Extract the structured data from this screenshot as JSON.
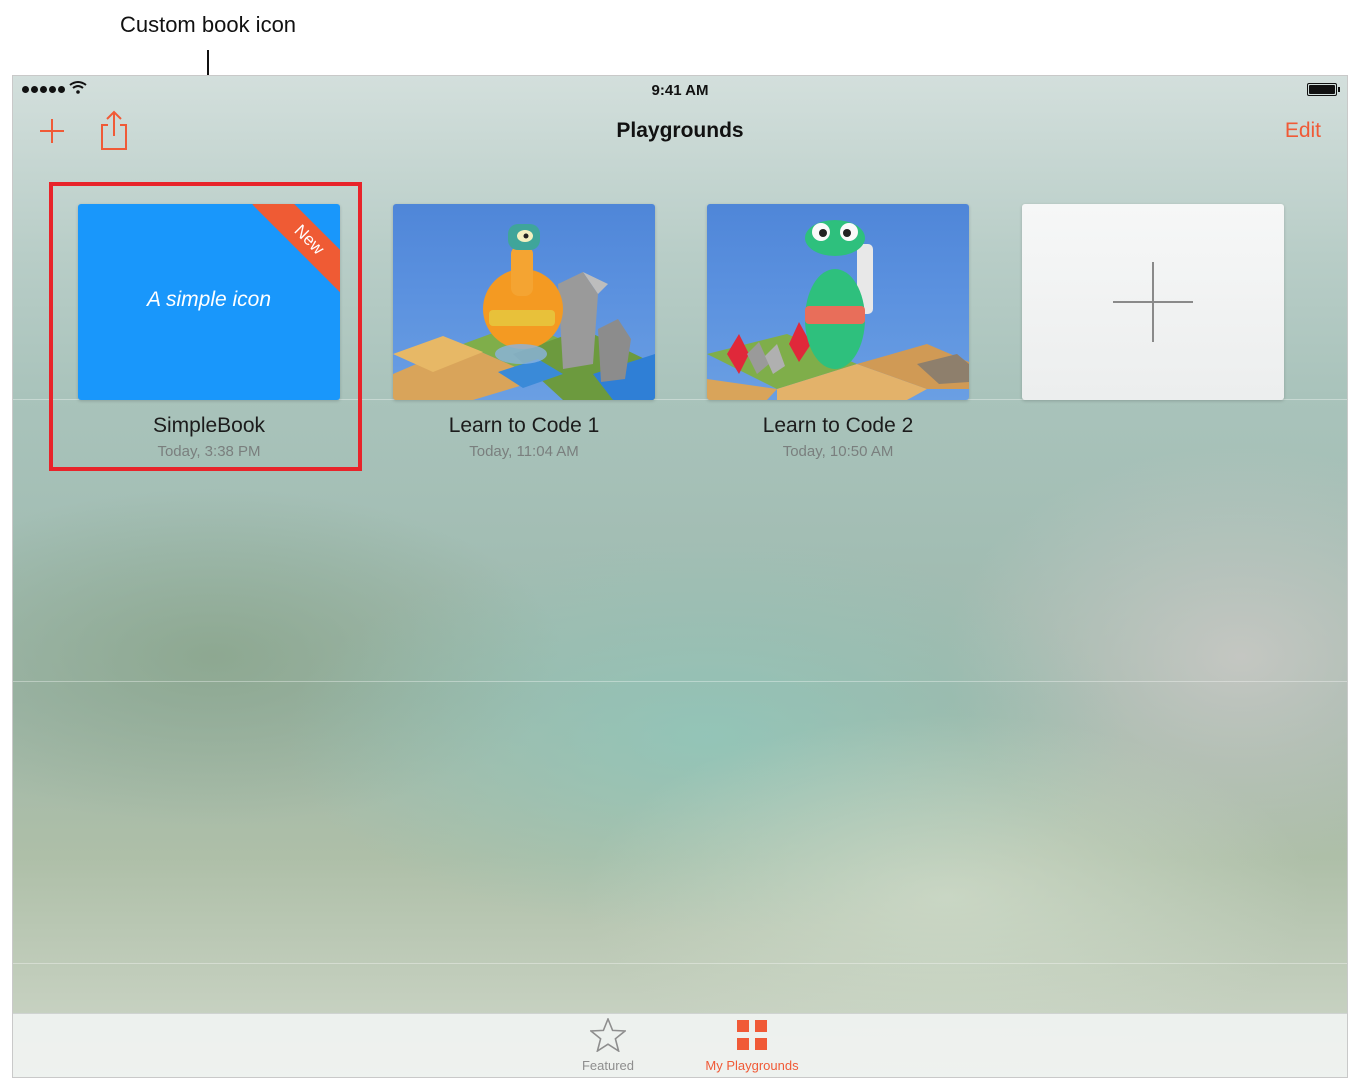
{
  "annotation": {
    "label": "Custom book icon"
  },
  "status_bar": {
    "time": "9:41 AM"
  },
  "nav_bar": {
    "title": "Playgrounds",
    "edit_label": "Edit"
  },
  "books": [
    {
      "title": "SimpleBook",
      "date": "Today, 3:38 PM",
      "cover_text": "A simple icon",
      "badge": "New",
      "cover_color": "#1997fb"
    },
    {
      "title": "Learn to Code 1",
      "date": "Today, 11:04 AM"
    },
    {
      "title": "Learn to Code 2",
      "date": "Today, 10:50 AM"
    }
  ],
  "tab_bar": {
    "items": [
      {
        "label": "Featured",
        "icon": "star-icon",
        "selected": false
      },
      {
        "label": "My Playgrounds",
        "icon": "grid-icon",
        "selected": true
      }
    ]
  },
  "colors": {
    "accent": "#f05a37",
    "highlight": "#e8232a"
  }
}
